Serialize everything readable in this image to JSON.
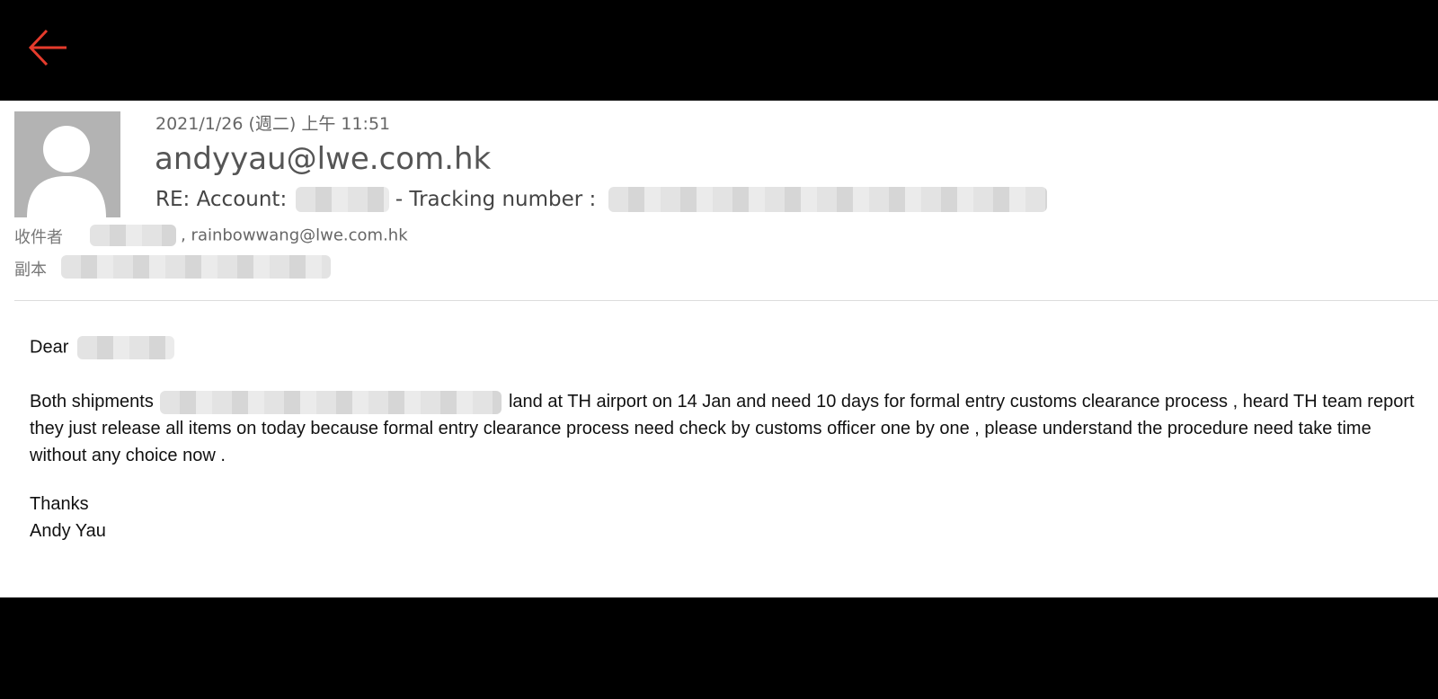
{
  "header": {
    "back_icon": "arrow-left-icon",
    "accent_color": "#e53b2c"
  },
  "email": {
    "datetime": "2021/1/26 (週二) 上午 11:51",
    "from": "andyyau@lwe.com.hk",
    "subject_prefix": "RE: Account:",
    "subject_middle": "- Tracking number :",
    "to_label": "收件者",
    "to_visible": ", rainbowwang@lwe.com.hk",
    "cc_label": "副本"
  },
  "body": {
    "greeting": "Dear",
    "para_start": "Both shipments",
    "para_rest": "land at TH airport on 14 Jan and need 10 days for formal entry customs clearance process , heard TH team report they just release all items on today because formal entry clearance process need check by customs officer one by one , please understand the procedure need take time without any choice now .",
    "signoff": "Thanks",
    "signature": "Andy Yau"
  }
}
